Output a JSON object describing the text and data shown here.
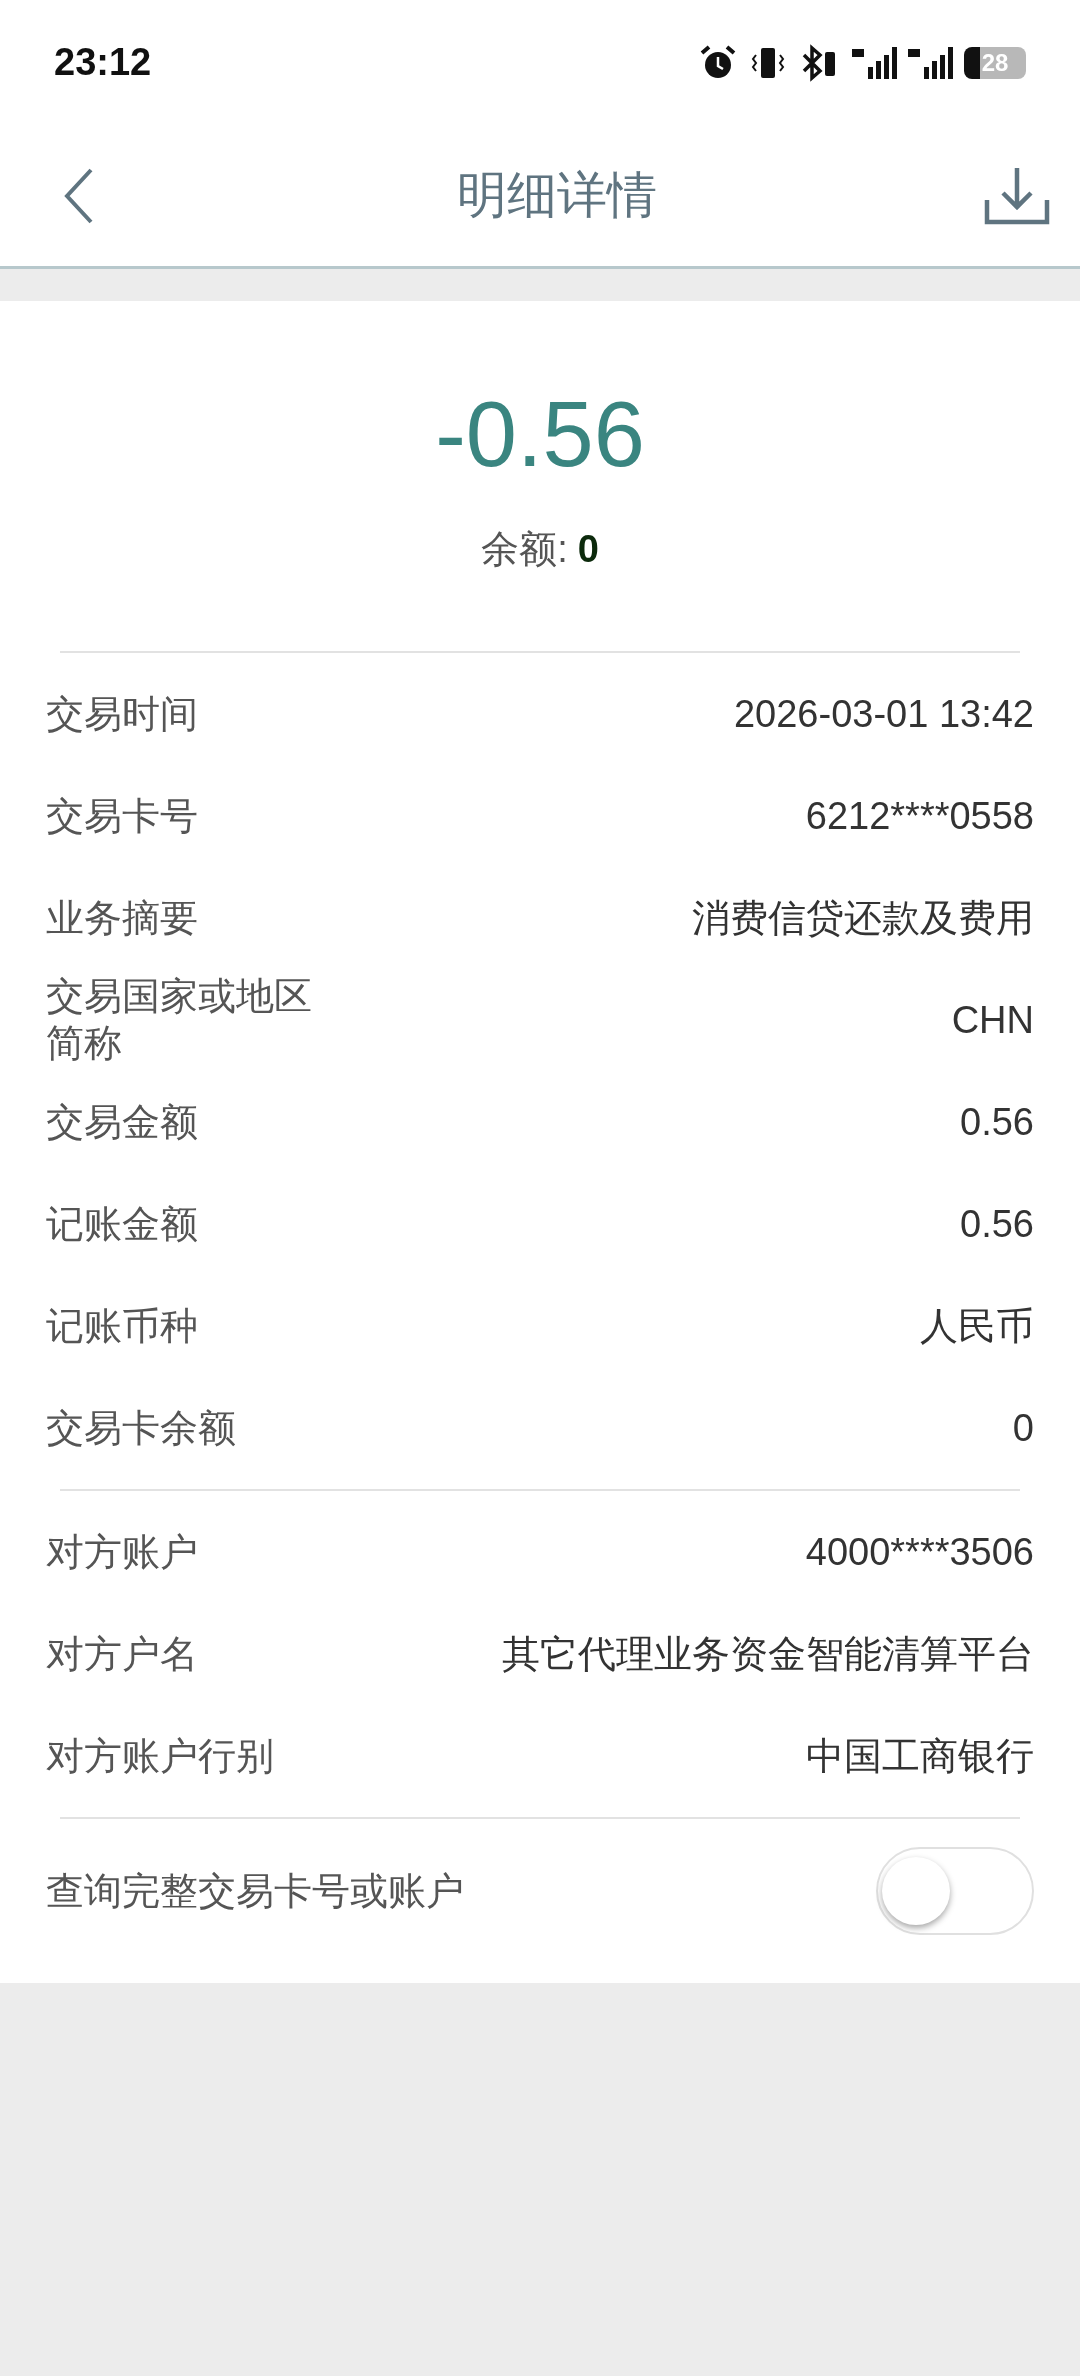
{
  "status_bar": {
    "time": "23:12",
    "battery": "28"
  },
  "header": {
    "title": "明细详情"
  },
  "summary": {
    "amount": "-0.56",
    "balance_label": "余额:",
    "balance_value": "0"
  },
  "sections": [
    {
      "rows": [
        {
          "label": "交易时间",
          "value": "2026-03-01 13:42"
        },
        {
          "label": "交易卡号",
          "value": "6212****0558"
        },
        {
          "label": "业务摘要",
          "value": "消费信贷还款及费用"
        },
        {
          "label": "交易国家或地区简称",
          "value": "CHN"
        },
        {
          "label": "交易金额",
          "value": "0.56"
        },
        {
          "label": "记账金额",
          "value": "0.56"
        },
        {
          "label": "记账币种",
          "value": "人民币"
        },
        {
          "label": "交易卡余额",
          "value": "0"
        }
      ]
    },
    {
      "rows": [
        {
          "label": "对方账户",
          "value": "4000****3506"
        },
        {
          "label": "对方户名",
          "value": "其它代理业务资金智能清算平台"
        },
        {
          "label": "对方账户行别",
          "value": "中国工商银行"
        }
      ]
    }
  ],
  "toggle": {
    "label": "查询完整交易卡号或账户",
    "on": false
  }
}
